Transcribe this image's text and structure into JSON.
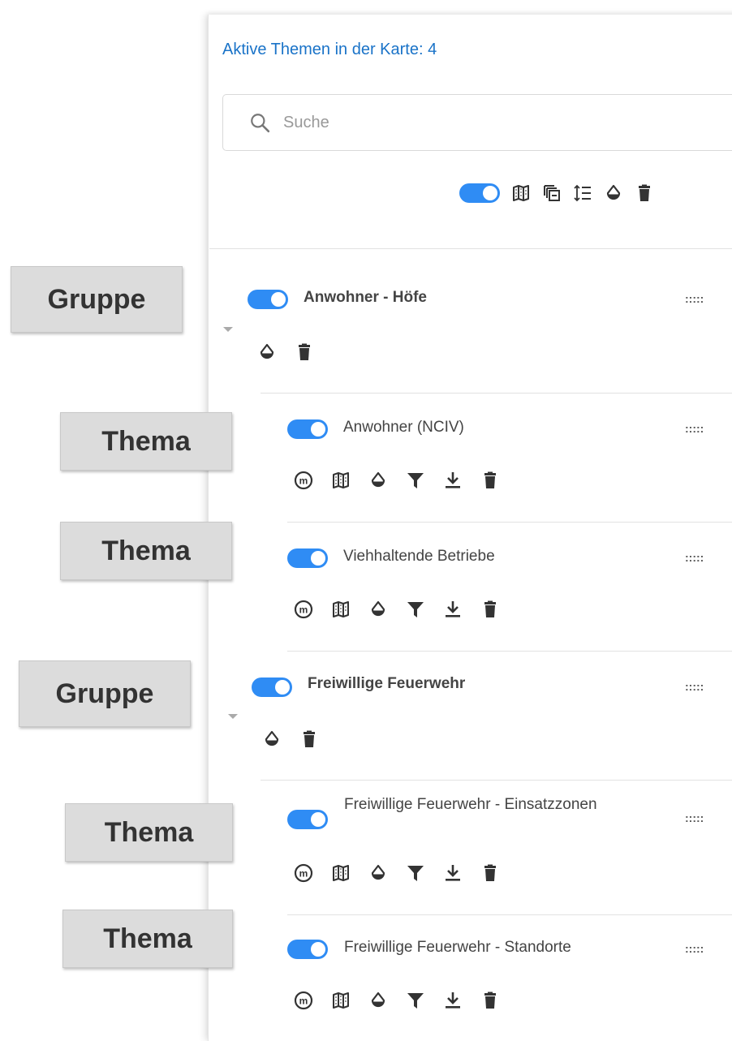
{
  "header": {
    "active_topics": "Aktive Themen in der Karte: 4"
  },
  "search": {
    "placeholder": "Suche"
  },
  "toolbar": {
    "icons": [
      "toggle",
      "map-icon",
      "copy-icon",
      "sort-icon",
      "opacity-icon",
      "trash-icon"
    ]
  },
  "layers": [
    {
      "type": "group",
      "title": "Anwohner - Höfe",
      "enabled": true,
      "handle": ":::::",
      "tag": "Gruppe",
      "actions": [
        "opacity-icon",
        "trash-icon"
      ]
    },
    {
      "type": "theme",
      "title": "Anwohner (NCIV)",
      "enabled": true,
      "handle": ":::::",
      "tag": "Thema",
      "actions": [
        "metadata-icon",
        "map-icon",
        "opacity-icon",
        "filter-icon",
        "download-icon",
        "trash-icon"
      ]
    },
    {
      "type": "theme",
      "title": "Viehhaltende Betriebe",
      "enabled": true,
      "handle": ":::::",
      "tag": "Thema",
      "actions": [
        "metadata-icon",
        "map-icon",
        "opacity-icon",
        "filter-icon",
        "download-icon",
        "trash-icon"
      ]
    },
    {
      "type": "group",
      "title": "Freiwillige Feuerwehr",
      "enabled": true,
      "handle": ":::::",
      "tag": "Gruppe",
      "actions": [
        "opacity-icon",
        "trash-icon"
      ]
    },
    {
      "type": "theme",
      "title": "Freiwillige Feuerwehr - Einsatzzonen",
      "enabled": true,
      "handle": ":::::",
      "tag": "Thema",
      "actions": [
        "metadata-icon",
        "map-icon",
        "opacity-icon",
        "filter-icon",
        "download-icon",
        "trash-icon"
      ]
    },
    {
      "type": "theme",
      "title": "Freiwillige Feuerwehr - Standorte",
      "enabled": true,
      "handle": ":::::",
      "tag": "Thema",
      "actions": [
        "metadata-icon",
        "map-icon",
        "opacity-icon",
        "filter-icon",
        "download-icon",
        "trash-icon"
      ]
    }
  ],
  "colors": {
    "accent": "#2f8cf4",
    "link": "#1a73c8",
    "icon": "#333333"
  }
}
